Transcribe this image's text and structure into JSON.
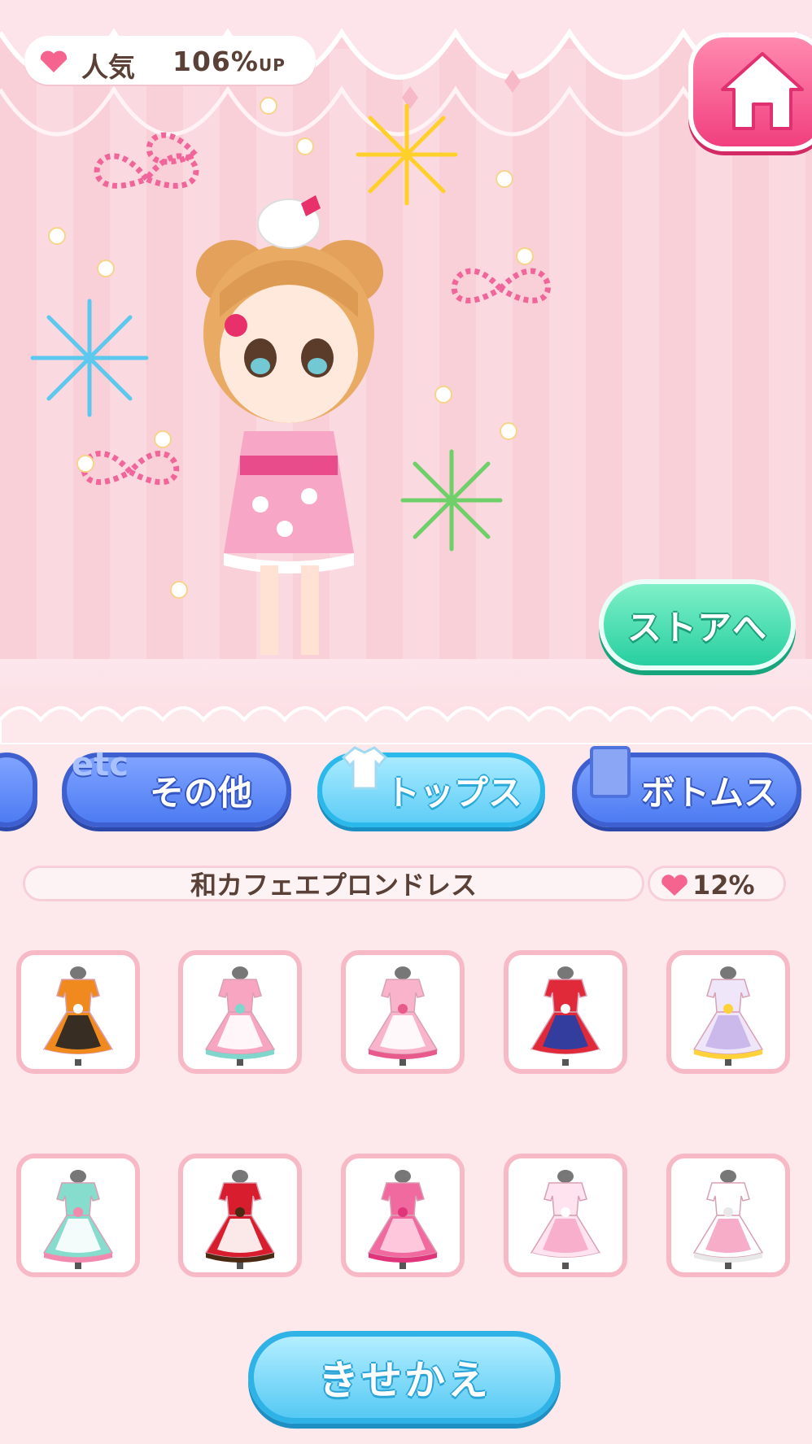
{
  "popularity": {
    "label": "人気",
    "value": "106%",
    "suffix": "UP"
  },
  "store_button": {
    "label": "ストアへ"
  },
  "category_tabs": [
    {
      "label": "",
      "icon": "partial-tab-icon",
      "state": "partial"
    },
    {
      "label": "その他",
      "icon": "etc-icon",
      "state": "inactive"
    },
    {
      "label": "トップス",
      "icon": "shirt-icon",
      "state": "active"
    },
    {
      "label": "ボトムス",
      "icon": "bottoms-icon",
      "state": "inactive"
    }
  ],
  "selected_item": {
    "name": "和カフェエプロンドレス",
    "bonus": "12%"
  },
  "items": [
    {
      "icon": "halloween-apron-dress-icon",
      "colors": [
        "#f08a1e",
        "#222222",
        "#ffffff"
      ]
    },
    {
      "icon": "pink-stripe-apron-dress-icon",
      "colors": [
        "#f7a5c1",
        "#ffffff",
        "#7fd6cc"
      ]
    },
    {
      "icon": "wa-cafe-apron-dress-icon",
      "colors": [
        "#f9b4cb",
        "#ffffff",
        "#e85a8c"
      ]
    },
    {
      "icon": "hello-kitty-red-dress-icon",
      "colors": [
        "#e02a3a",
        "#1f3fa8",
        "#ffffff"
      ]
    },
    {
      "icon": "star-lavender-dress-icon",
      "colors": [
        "#efe6fa",
        "#c7b4ea",
        "#ffd23a"
      ]
    },
    {
      "icon": "mint-stripe-apron-dress-icon",
      "colors": [
        "#86dccd",
        "#ffffff",
        "#f28ab0"
      ]
    },
    {
      "icon": "red-santa-dress-icon",
      "colors": [
        "#d81e2e",
        "#ffffff",
        "#4a2a12"
      ]
    },
    {
      "icon": "pink-ribbon-dress-icon",
      "colors": [
        "#f06aa0",
        "#ffd2e2",
        "#e0357a"
      ]
    },
    {
      "icon": "light-pink-bow-dress-icon",
      "colors": [
        "#ffe3ee",
        "#f7a9c8",
        "#ffffff"
      ]
    },
    {
      "icon": "white-bow-dress-icon",
      "colors": [
        "#ffffff",
        "#f6a3c2",
        "#e8e8e8"
      ]
    }
  ],
  "dress_button": {
    "label": "きせかえ"
  },
  "theme": {
    "heart": "#f5648f",
    "home": "#f24b86",
    "store": "#34d5a7",
    "tab_blue": "#5580f3",
    "tab_active": "#63cff6"
  }
}
